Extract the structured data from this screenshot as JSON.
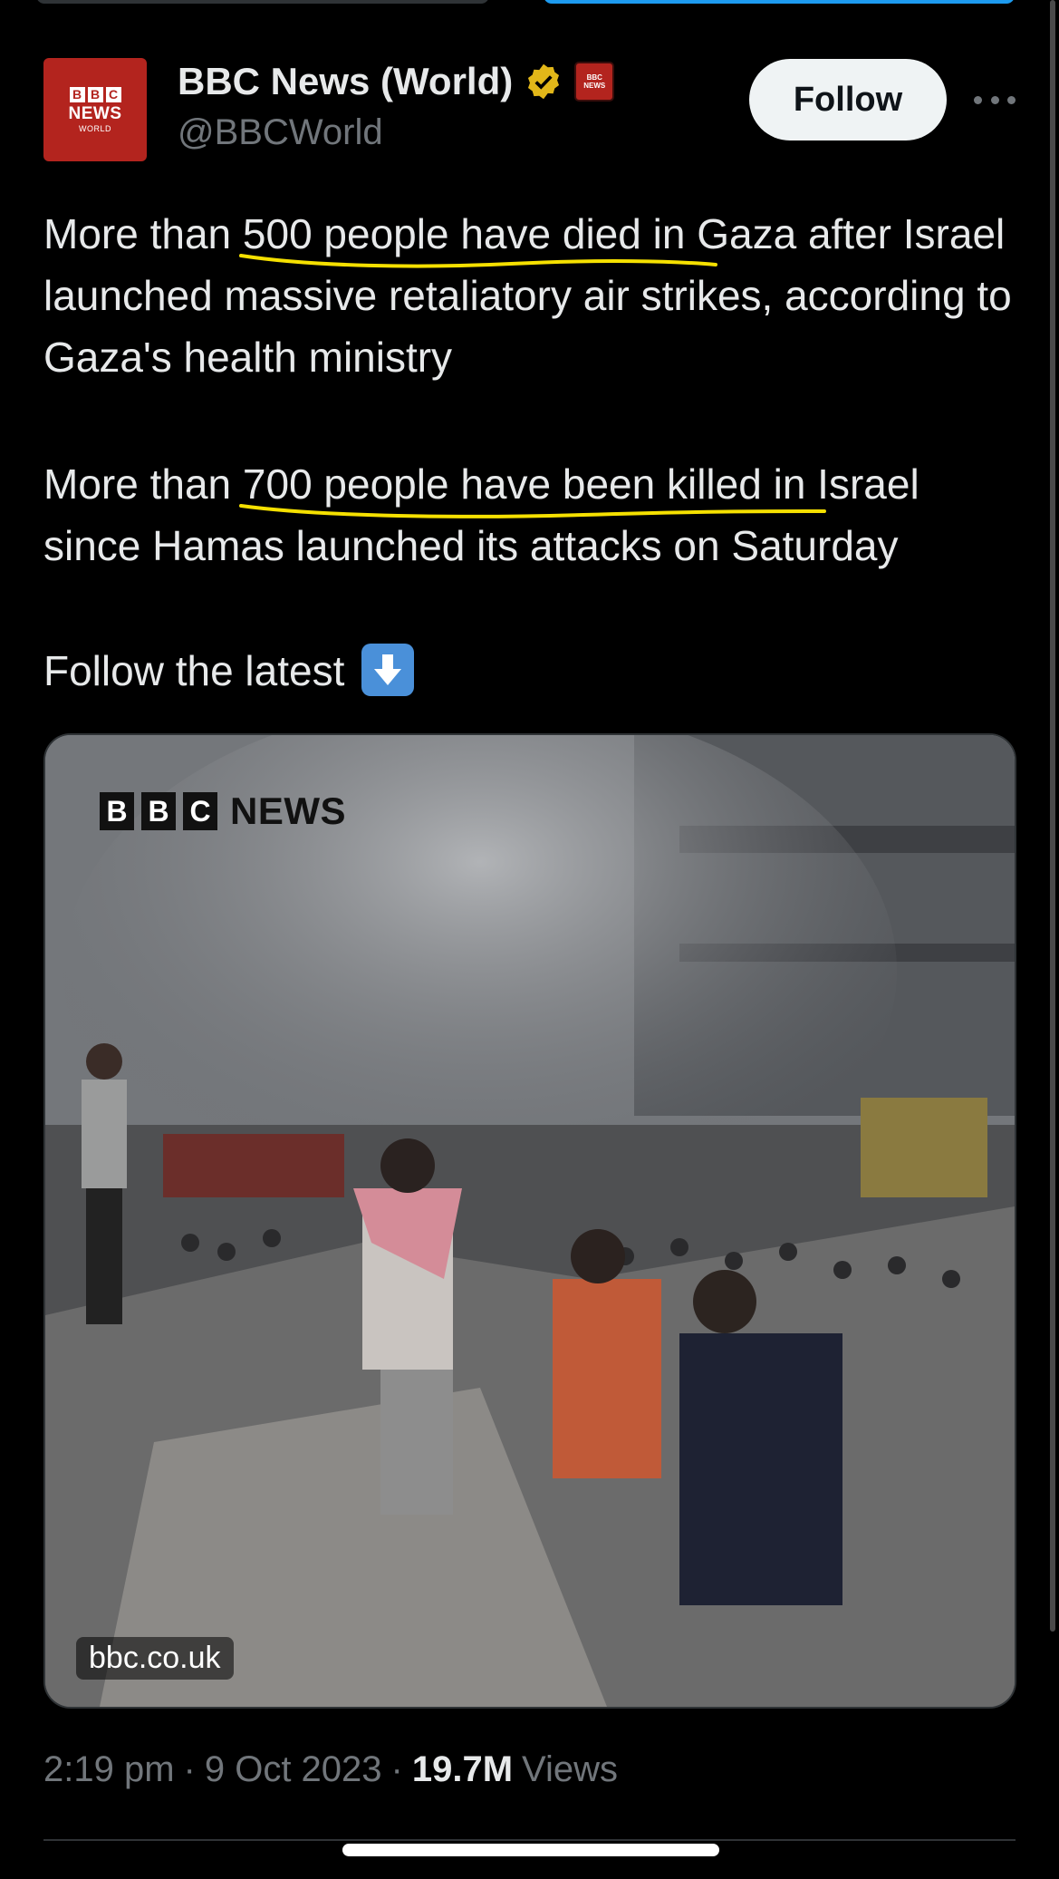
{
  "account": {
    "avatar_text": {
      "blocks": [
        "B",
        "B",
        "C"
      ],
      "news": "NEWS",
      "world": "WORLD"
    },
    "display_name": "BBC News (World)",
    "handle": "@BBCWorld",
    "affiliation_badge": "BBC NEWS",
    "verified_color": "#e2b719"
  },
  "actions": {
    "follow_label": "Follow"
  },
  "tweet": {
    "p1_pre": "More than ",
    "p1_highlight": "500 people have died in",
    "p1_post": " Gaza after Israel launched massive retaliatory air strikes, according to Gaza's health ministry",
    "p2_pre": "More than ",
    "p2_highlight": "700 people have been killed in",
    "p2_post": " Israel since Hamas launched its attacks on Saturday",
    "p3": "Follow the latest",
    "p3_emoji": "down-arrow-emoji",
    "highlight_color": "#f5e000"
  },
  "media": {
    "logo_blocks": [
      "B",
      "B",
      "C"
    ],
    "logo_news": "NEWS",
    "link": "bbc.co.uk"
  },
  "meta": {
    "time": "2:19 pm",
    "sep1": "·",
    "date": "9 Oct 2023",
    "sep2": "·",
    "views_count": "19.7M",
    "views_label": "Views"
  }
}
